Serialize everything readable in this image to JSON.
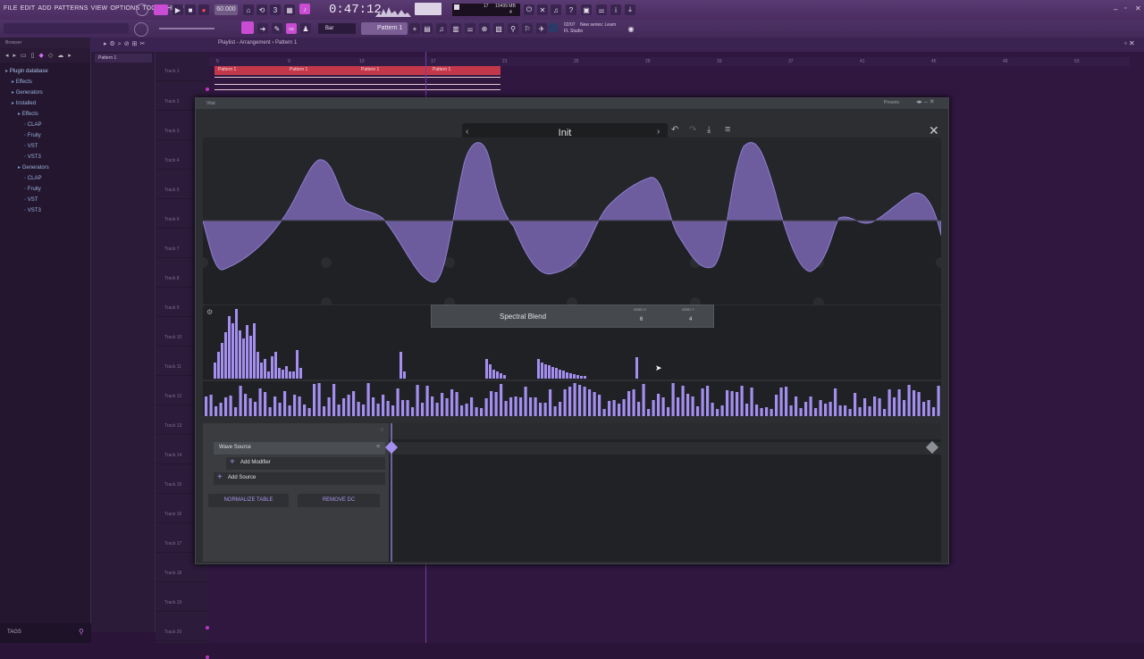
{
  "menu": [
    "FILE",
    "EDIT",
    "ADD",
    "PATTERNS",
    "VIEW",
    "OPTIONS",
    "TOOLS",
    "HELP"
  ],
  "transport": {
    "tempo": "60.000",
    "time": "0:47:12",
    "pattern": "Pattern 1",
    "snap": "Bar",
    "cpu_value": "17",
    "memory": "10499 MB",
    "memory_sub": "4",
    "news_line1": "New series: Learn",
    "news_line2": "FL Studio",
    "news_date": "02/07"
  },
  "browser": {
    "title": "Browser",
    "tree": [
      {
        "label": "Plugin database",
        "indent": 0
      },
      {
        "label": "Effects",
        "indent": 1
      },
      {
        "label": "Generators",
        "indent": 1
      },
      {
        "label": "Installed",
        "indent": 1
      },
      {
        "label": "Effects",
        "indent": 2
      },
      {
        "label": "CLAP",
        "indent": 3
      },
      {
        "label": "Fruity",
        "indent": 3
      },
      {
        "label": "VST",
        "indent": 3
      },
      {
        "label": "VST3",
        "indent": 3
      },
      {
        "label": "Generators",
        "indent": 2
      },
      {
        "label": "CLAP",
        "indent": 3
      },
      {
        "label": "Fruity",
        "indent": 3
      },
      {
        "label": "VST",
        "indent": 3
      },
      {
        "label": "VST3",
        "indent": 3
      }
    ],
    "tags_label": "TAGS"
  },
  "playlist": {
    "title": "Playlist - Arrangement › Pattern 1",
    "pattern_item": "Pattern 1",
    "clips": [
      "Pattern 1",
      "Pattern 1",
      "Pattern 1",
      "Pattern 1"
    ],
    "tracks": [
      "Track 1",
      "Track 2",
      "Track 3",
      "Track 4",
      "Track 5",
      "Track 6",
      "Track 7",
      "Track 8",
      "Track 9",
      "Track 10",
      "Track 11",
      "Track 12",
      "Track 13",
      "Track 14",
      "Track 15",
      "Track 16",
      "Track 17",
      "Track 18",
      "Track 19",
      "Track 20"
    ],
    "ruler": [
      "5",
      "9",
      "13",
      "17",
      "21",
      "25",
      "29",
      "33",
      "37",
      "41",
      "45",
      "49",
      "53"
    ]
  },
  "vital": {
    "window_title": "Vital",
    "presets_label": "Presets",
    "preset_name": "Init",
    "spectral_blend": "Spectral Blend",
    "grid_x_label": "GRID X",
    "grid_x_value": "6",
    "grid_y_label": "GRID Y",
    "grid_y_value": "4",
    "source_name": "Wave Source",
    "add_modifier": "Add Modifier",
    "add_source": "Add Source",
    "normalize_btn": "NORMALIZE TABLE",
    "remove_dc_btn": "REMOVE DC",
    "keyframe_start": "0",
    "colors": {
      "accent": "#a48ef0",
      "wave_fill": "#7866b0",
      "panel": "#1f2124",
      "bg": "#2c2e31"
    }
  }
}
